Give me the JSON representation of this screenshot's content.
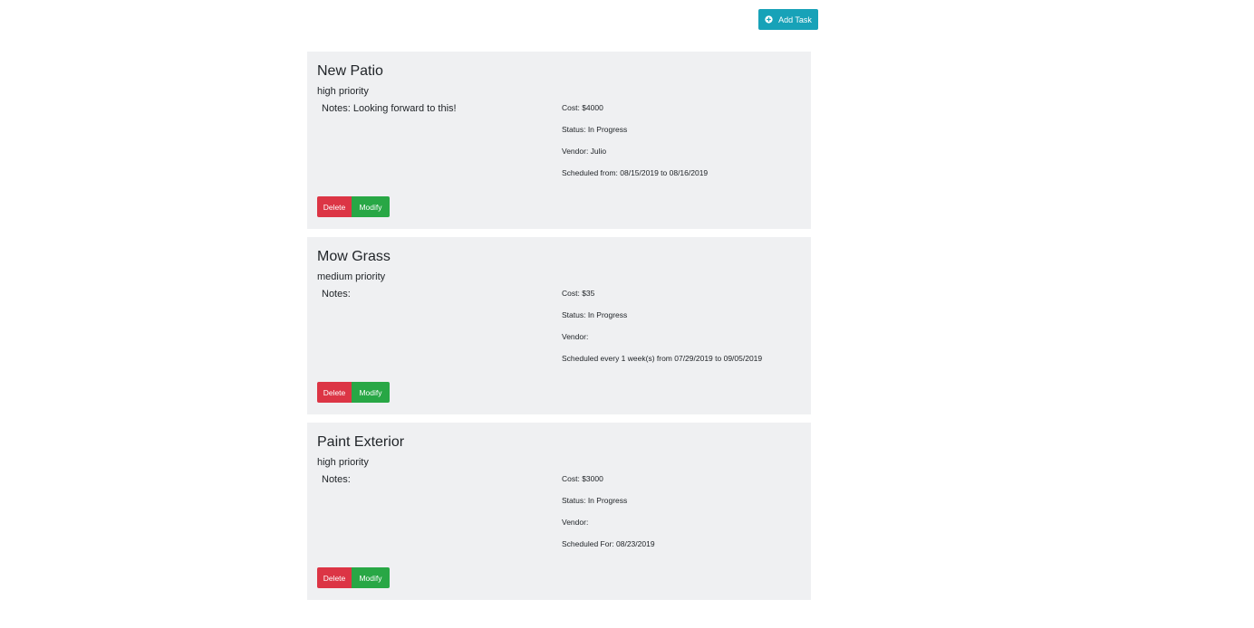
{
  "toolbar": {
    "add_task_label": "Add Task",
    "add_task_icon": "plus-circle-icon"
  },
  "colors": {
    "add_button": "#17a2b8",
    "delete_button": "#dc3545",
    "modify_button": "#28a745",
    "card_background": "#eff0f2"
  },
  "tasks": [
    {
      "title": "New Patio",
      "priority": "high priority",
      "notes": "Notes: Looking forward to this!",
      "cost": "Cost: $4000",
      "status": "Status: In Progress",
      "vendor": "Vendor: Julio",
      "schedule": "Scheduled from: 08/15/2019 to 08/16/2019",
      "delete_label": "Delete",
      "modify_label": "Modify"
    },
    {
      "title": "Mow Grass",
      "priority": "medium priority",
      "notes": "Notes:",
      "cost": "Cost: $35",
      "status": "Status: In Progress",
      "vendor": "Vendor:",
      "schedule": "Scheduled every 1 week(s) from 07/29/2019 to 09/05/2019",
      "delete_label": "Delete",
      "modify_label": "Modify"
    },
    {
      "title": "Paint Exterior",
      "priority": "high priority",
      "notes": "Notes:",
      "cost": "Cost: $3000",
      "status": "Status: In Progress",
      "vendor": "Vendor:",
      "schedule": "Scheduled For: 08/23/2019",
      "delete_label": "Delete",
      "modify_label": "Modify"
    }
  ]
}
